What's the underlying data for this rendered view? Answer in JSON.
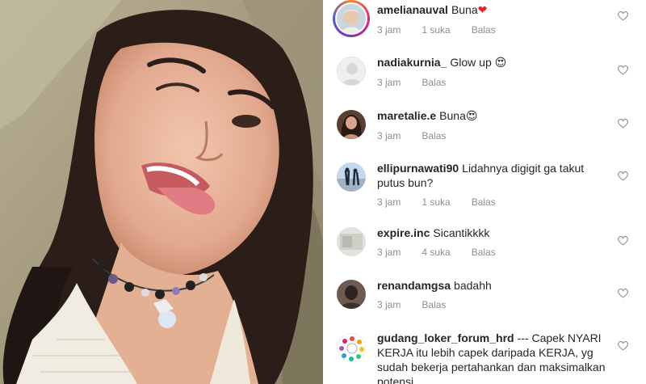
{
  "post_photo": {
    "description_name": "selfie-photo"
  },
  "comments": [
    {
      "username": "amelianauval",
      "text": "Buna",
      "emoji": "❤",
      "emoji_color": "#e0262a",
      "time": "3 jam",
      "likes": "1 suka",
      "reply": "Balas",
      "avatar_type": "story"
    },
    {
      "username": "nadiakurnia_",
      "text": "Glow up",
      "emoji": "😍",
      "emoji_color": "#f2b705",
      "time": "3 jam",
      "likes": "",
      "reply": "Balas",
      "avatar_type": "default"
    },
    {
      "username": "maretalie.e",
      "text": "Buna",
      "emoji": "😍",
      "emoji_color": "#f2b705",
      "time": "3 jam",
      "likes": "",
      "reply": "Balas",
      "avatar_type": "photo-dark"
    },
    {
      "username": "ellipurnawati90",
      "text": "Lidahnya digigit ga takut putus bun?",
      "emoji": "",
      "time": "3 jam",
      "likes": "1 suka",
      "reply": "Balas",
      "avatar_type": "photo-sky"
    },
    {
      "username": "expire.inc",
      "text": "Sicantikkkk",
      "emoji": "",
      "time": "3 jam",
      "likes": "4 suka",
      "reply": "Balas",
      "avatar_type": "photo-grey"
    },
    {
      "username": "renandamgsa",
      "text": "badahh",
      "emoji": "",
      "time": "3 jam",
      "likes": "",
      "reply": "Balas",
      "avatar_type": "photo-dark2"
    },
    {
      "username": "gudang_loker_forum_hrd",
      "text": "--- Capek NYARI KERJA itu lebih capek daripada KERJA, yg sudah bekerja pertahankan dan maksimalkan potensi",
      "emoji": "",
      "time": "",
      "likes": "",
      "reply": "",
      "avatar_type": "logo"
    }
  ],
  "colors": {
    "text": "#262626",
    "meta": "#8e8e8e",
    "heart_outline": "#8e8e8e"
  },
  "icons": {
    "like": "heart-outline-icon",
    "default_avatar": "user-silhouette-icon"
  }
}
